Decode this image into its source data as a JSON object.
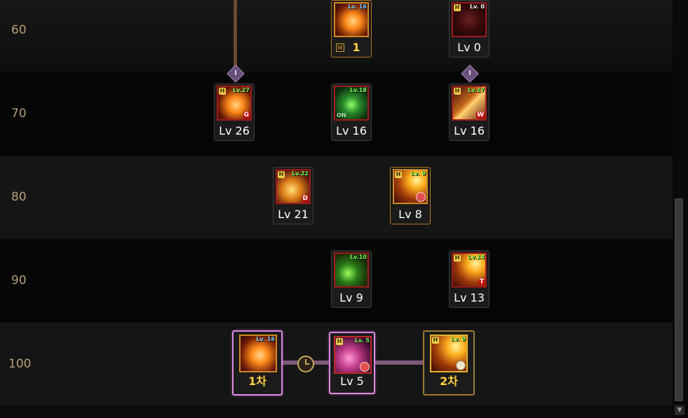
{
  "rows": [
    {
      "level": "60"
    },
    {
      "level": "70"
    },
    {
      "level": "80"
    },
    {
      "level": "90"
    },
    {
      "level": "100"
    }
  ],
  "connectors": {
    "diamond_label": "I"
  },
  "skills": {
    "r60_a": {
      "tag": "Lv. 16",
      "level": "1",
      "badge": "M"
    },
    "r60_b": {
      "tag": "Lv. 0",
      "level": "Lv 0",
      "badge": "H"
    },
    "r70_a": {
      "tag": "Lv.27",
      "level": "Lv 26",
      "badge": "H",
      "corner": "G"
    },
    "r70_b": {
      "tag": "Lv.18",
      "level": "Lv 16",
      "corner": "ON"
    },
    "r70_c": {
      "tag": "Lv.17",
      "level": "Lv 16",
      "badge": "H",
      "corner": "W"
    },
    "r80_a": {
      "tag": "Lv.22",
      "level": "Lv 21",
      "badge": "H",
      "corner": "D"
    },
    "r80_b": {
      "tag": "Lv. 9",
      "level": "Lv 8",
      "badge": "H"
    },
    "r90_a": {
      "tag": "Lv.10",
      "level": "Lv 9"
    },
    "r90_b": {
      "tag": "Lv.14",
      "level": "Lv 13",
      "badge": "H",
      "corner": "T"
    },
    "r100_a": {
      "tag": "Lv. 16",
      "level": "1차"
    },
    "r100_b": {
      "tag": "Lv. 5",
      "level": "Lv 5",
      "badge": "H"
    },
    "r100_c": {
      "tag": "Lv. 9",
      "level": "2차",
      "badge": "H"
    }
  }
}
